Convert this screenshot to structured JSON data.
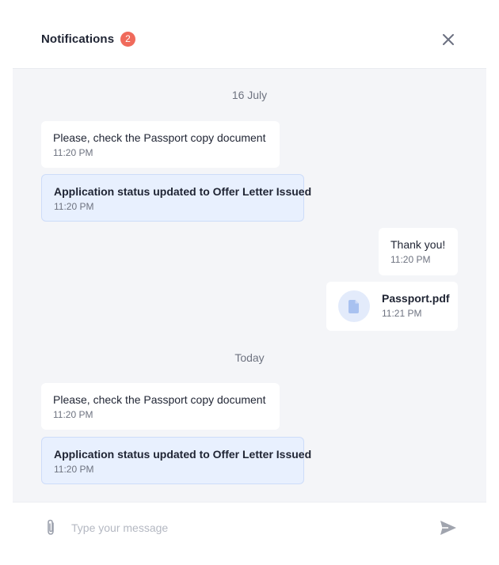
{
  "header": {
    "title": "Notifications",
    "badge_count": "2",
    "close_icon": "close-icon"
  },
  "colors": {
    "badge": "#f06a5b",
    "thread_background": "#f4f5f8",
    "status_message_background": "#e8f0fe",
    "muted_text": "#6e7380"
  },
  "thread": {
    "groups": [
      {
        "date": "16 July",
        "messages": [
          {
            "text": "Please, check the Passport copy document",
            "time": "11:20 PM"
          },
          {
            "text": "Application status updated to Offer Letter Issued",
            "time": "11:20 PM"
          },
          {
            "text": "Thank you!",
            "time": "11:20 PM"
          },
          {
            "file_name": "Passport.pdf",
            "time": "11:21 PM",
            "icon": "document-icon"
          }
        ]
      },
      {
        "date": "Today",
        "messages": [
          {
            "text": "Please, check the Passport copy document",
            "time": "11:20 PM"
          },
          {
            "text": "Application status updated to Offer Letter Issued",
            "time": "11:20 PM"
          }
        ]
      }
    ]
  },
  "composer": {
    "placeholder": "Type your message",
    "value": "",
    "attach_icon": "paperclip-icon",
    "send_icon": "send-icon"
  }
}
